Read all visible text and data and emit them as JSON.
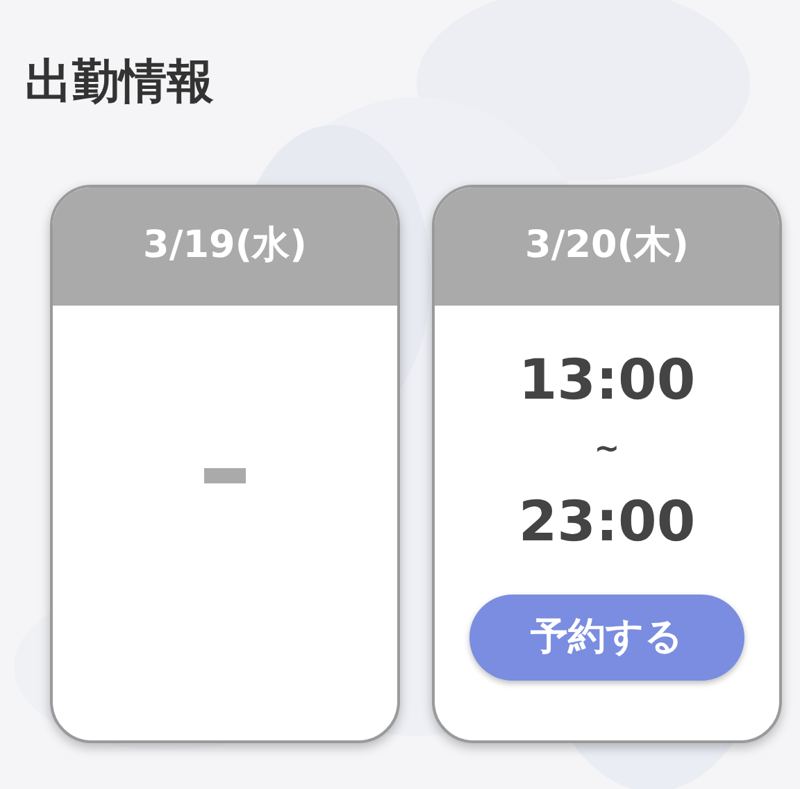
{
  "title": "出勤情報",
  "days": [
    {
      "kind": "empty",
      "date": "3/19(水)"
    },
    {
      "kind": "shift",
      "date": "3/20(木)",
      "start": "13:00",
      "separator": "~",
      "end": "23:00",
      "button": "予約する"
    }
  ]
}
